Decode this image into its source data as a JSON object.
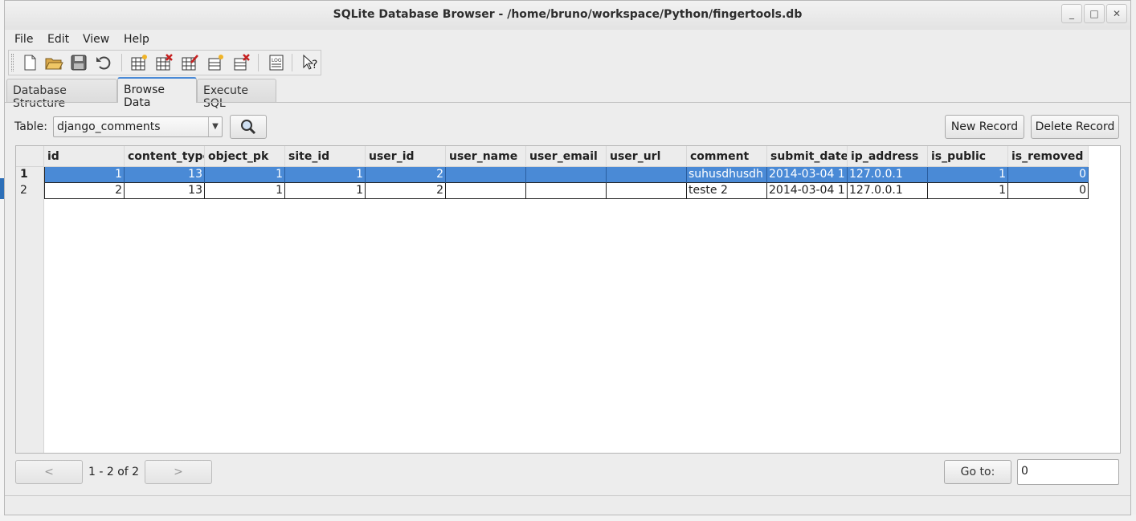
{
  "window": {
    "title": "SQLite Database Browser - /home/bruno/workspace/Python/fingertools.db",
    "minimize": "_",
    "maximize": "□",
    "close": "✕"
  },
  "menu": [
    "File",
    "Edit",
    "View",
    "Help"
  ],
  "toolbar": {
    "buttons": [
      "new-database-icon",
      "open-database-icon",
      "save-icon",
      "undo-icon",
      "create-table-icon",
      "delete-table-icon",
      "modify-table-icon",
      "create-index-icon",
      "delete-index-icon",
      "sql-log-icon",
      "whats-this-icon"
    ]
  },
  "tabs": [
    {
      "label": "Database Structure",
      "active": false
    },
    {
      "label": "Browse Data",
      "active": true
    },
    {
      "label": "Execute SQL",
      "active": false
    }
  ],
  "browse": {
    "table_label": "Table:",
    "table_value": "django_comments",
    "new_record": "New Record",
    "delete_record": "Delete Record",
    "prev": "<",
    "next": ">",
    "page_info": "1 - 2 of 2",
    "goto_label": "Go to:",
    "goto_value": "0"
  },
  "grid": {
    "columns": [
      "id",
      "content_type",
      "object_pk",
      "site_id",
      "user_id",
      "user_name",
      "user_email",
      "user_url",
      "comment",
      "submit_date",
      "ip_address",
      "is_public",
      "is_removed"
    ],
    "rows": [
      {
        "header": "1",
        "selected": true,
        "cells": [
          "1",
          "13",
          "1",
          "1",
          "2",
          "",
          "",
          "",
          "suhusdhusdh",
          "2014-03-04 1",
          "127.0.0.1",
          "1",
          "0"
        ]
      },
      {
        "header": "2",
        "selected": false,
        "cells": [
          "2",
          "13",
          "1",
          "1",
          "2",
          "",
          "",
          "",
          "teste 2",
          "2014-03-04 1",
          "127.0.0.1",
          "1",
          "0"
        ]
      }
    ],
    "numeric_columns": [
      0,
      1,
      2,
      3,
      4,
      11,
      12
    ]
  },
  "colors": {
    "selection": "#4a8ad6",
    "tab_accent": "#4a8ad6"
  }
}
